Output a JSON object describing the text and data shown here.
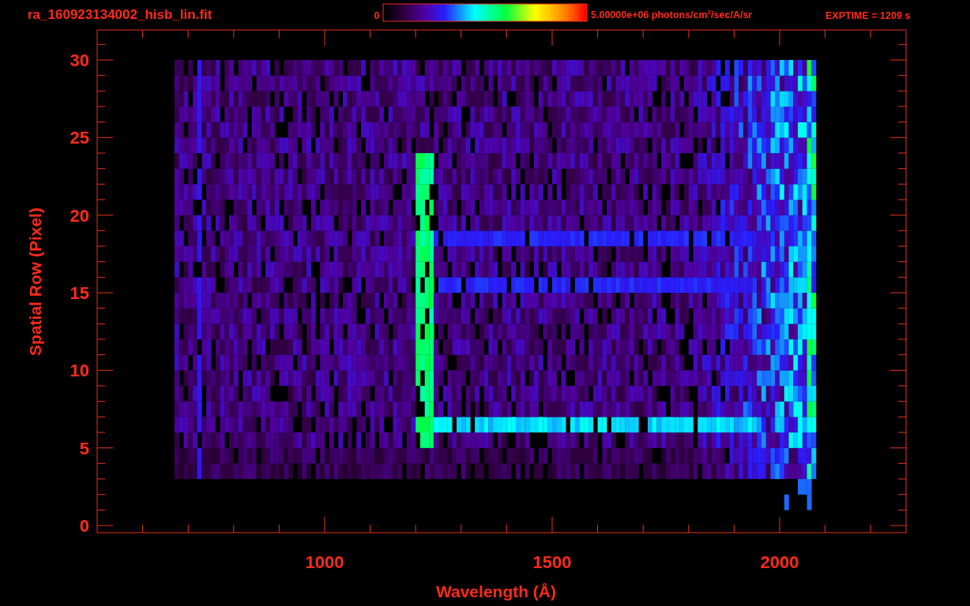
{
  "title": "ra_160923134002_hisb_lin.fit",
  "colorbar": {
    "min_label": "0",
    "max_label": "5.00000e+06 photons/cm$^{2}$/sec/A/sr"
  },
  "exposure": "EXPTIME = 1209 s",
  "y_axis": {
    "label": "Spatial Row (Pixel)",
    "ticks": [
      "30",
      "25",
      "20",
      "15",
      "10",
      "5",
      "0"
    ]
  },
  "x_axis": {
    "label": "Wavelength (Å)",
    "ticks": [
      "1000",
      "1500",
      "2000"
    ]
  }
}
